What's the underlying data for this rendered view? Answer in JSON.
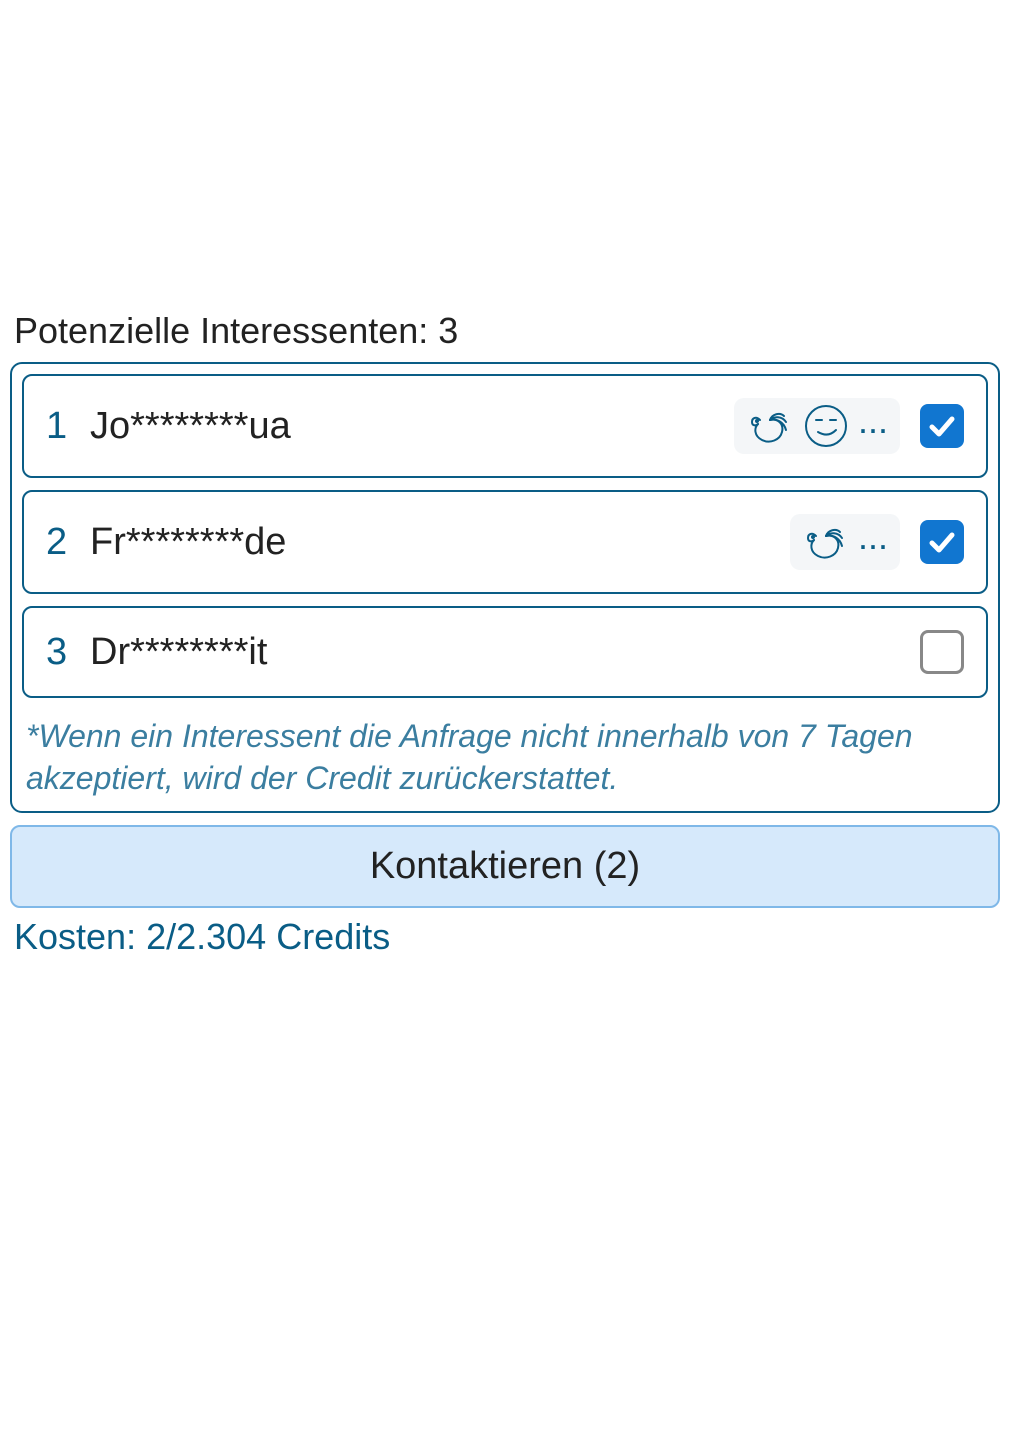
{
  "heading_prefix": "Potenzielle Interessenten:",
  "count": "3",
  "rows": [
    {
      "num": "1",
      "name": "Jo********ua",
      "badges": [
        "turkey",
        "smirk"
      ],
      "more": true,
      "checked": true
    },
    {
      "num": "2",
      "name": "Fr********de",
      "badges": [
        "turkey"
      ],
      "more": true,
      "checked": true
    },
    {
      "num": "3",
      "name": "Dr********it",
      "badges": [],
      "more": false,
      "checked": false
    }
  ],
  "disclaimer": "*Wenn ein Interessent die Anfrage nicht innerhalb von 7 Tagen akzeptiert, wird der Credit zurückerstattet.",
  "contact_label": "Kontaktieren (2)",
  "cost_label": "Kosten: 2/2.304 Credits",
  "colors": {
    "primary": "#0a5d86",
    "checkbox": "#1176d0",
    "button_bg": "#d6e9fb"
  }
}
